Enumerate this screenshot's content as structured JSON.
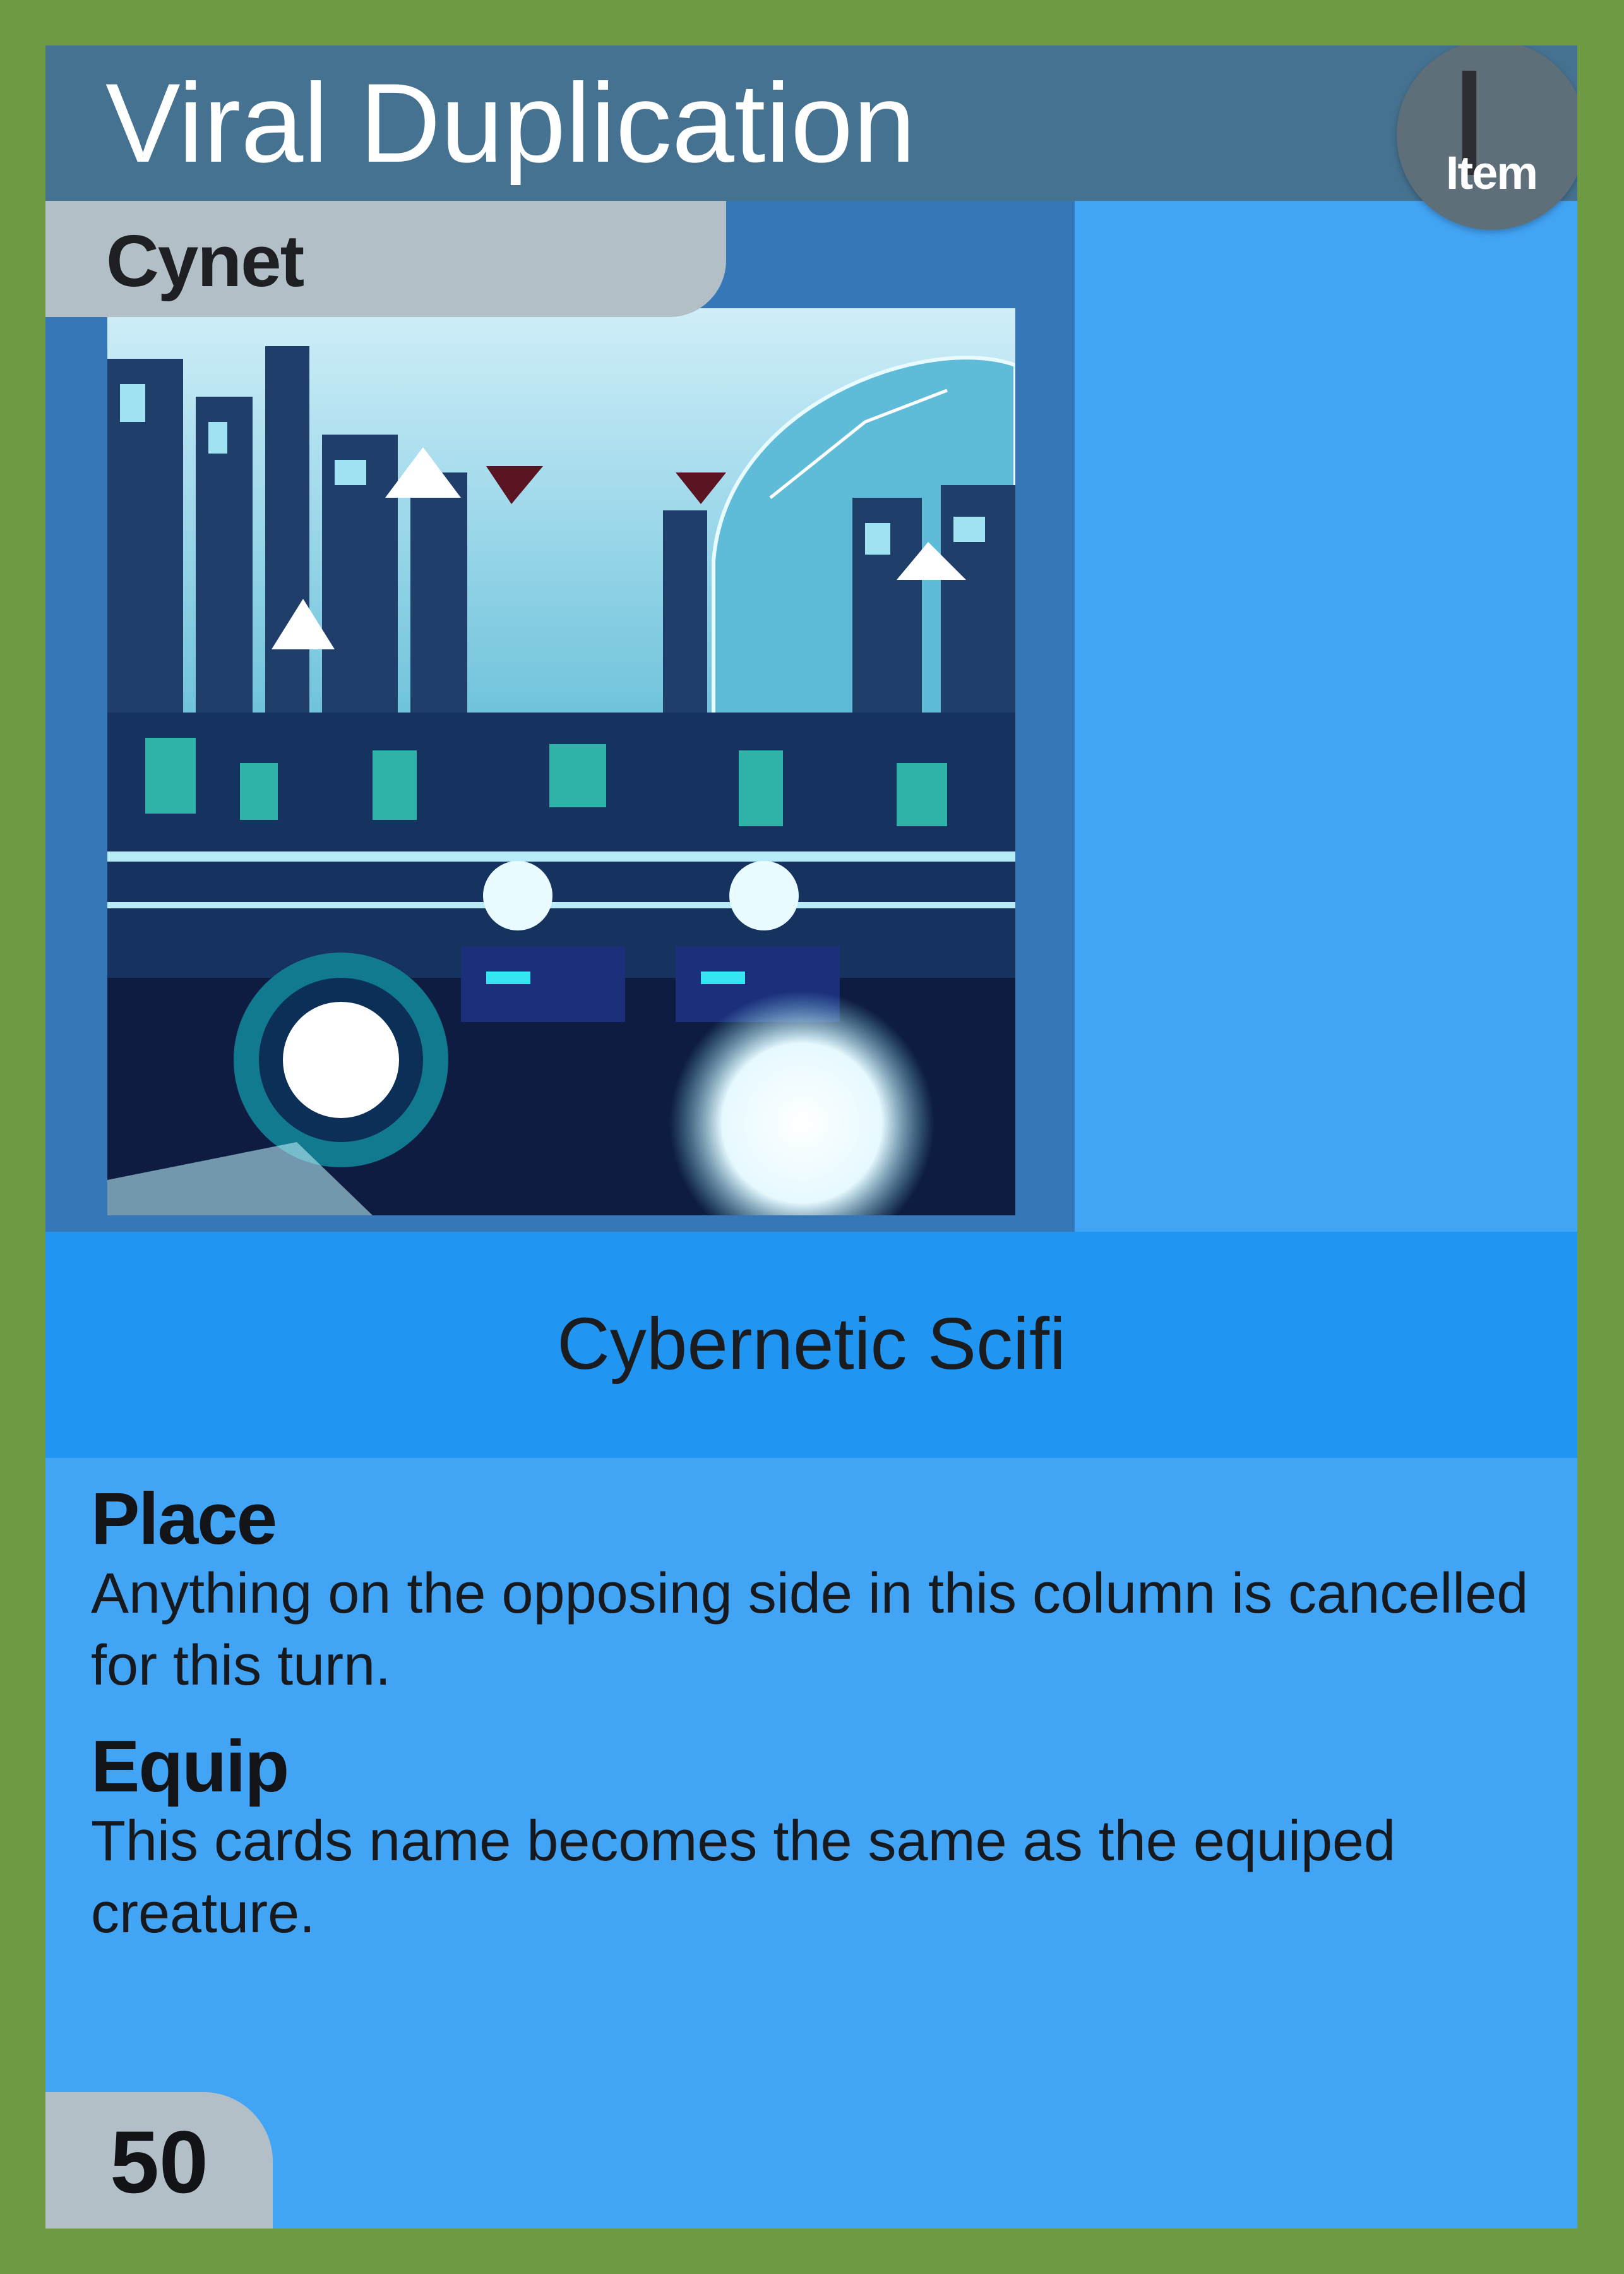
{
  "card": {
    "title": "Viral Duplication",
    "type_letter": "I",
    "type_label": "Item",
    "faction": "Cynet",
    "subtype": "Cybernetic Scifi",
    "abilities": [
      {
        "name": "Place",
        "text": "Anything on the opposing side in this column is cancelled for this turn."
      },
      {
        "name": "Equip",
        "text": "This cards name becomes the same as the equiped creature."
      }
    ],
    "cost": "50"
  },
  "colors": {
    "border": "#6d9a42",
    "card_body": "#42a4f5",
    "title_bar": "#457290",
    "art_frame": "#3678b7",
    "subtype_band": "#2195f2",
    "tab_gray": "#b3bfc6"
  },
  "art": {
    "description_icon": "cyber-city-illustration"
  }
}
